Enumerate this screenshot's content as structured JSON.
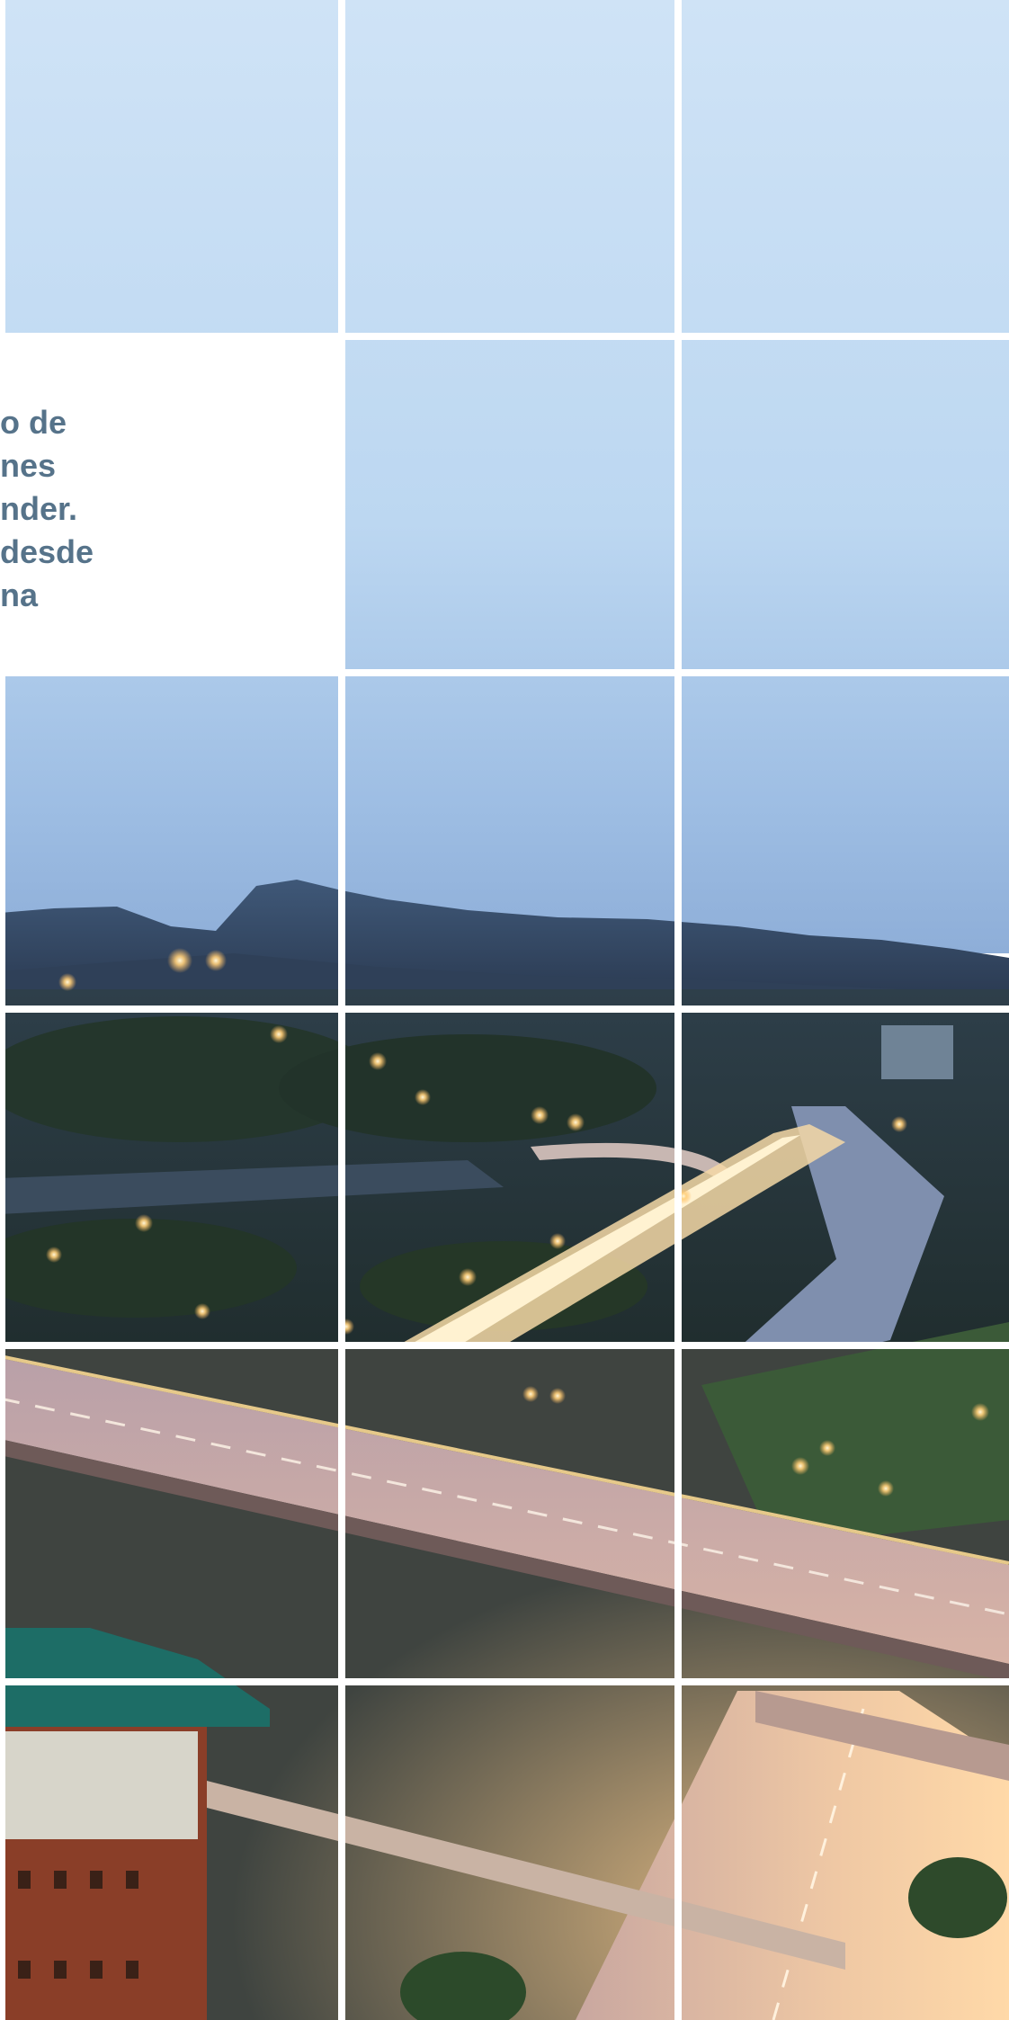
{
  "text_panel": {
    "lines": [
      "o de",
      "nes",
      "nder.",
      "desde",
      "na"
    ]
  },
  "colors": {
    "sky_top": "#c4def5",
    "sky_bottom": "#8fb2de",
    "text": "#56738a",
    "grid_gutter": "#ffffff",
    "light_glow": "#ffbf6a",
    "roof_green": "#1d6d66",
    "brick": "#8a3e28"
  }
}
